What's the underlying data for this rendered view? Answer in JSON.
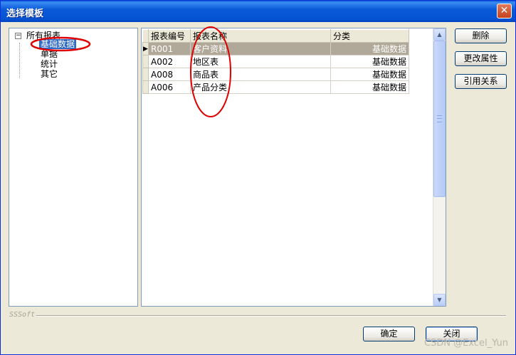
{
  "window": {
    "title": "选择模板",
    "close_glyph": "✕"
  },
  "tree": {
    "expander_glyph": "−",
    "root_label": "所有报表",
    "children": [
      {
        "label": "基础数据",
        "selected": true
      },
      {
        "label": "单据",
        "selected": false
      },
      {
        "label": "统计",
        "selected": false
      },
      {
        "label": "其它",
        "selected": false
      }
    ]
  },
  "grid": {
    "columns": [
      "报表编号",
      "报表名称",
      "分类"
    ],
    "current_row_marker": "▶",
    "rows": [
      {
        "code": "R001",
        "name": "客户资料",
        "category": "基础数据",
        "selected": true
      },
      {
        "code": "A002",
        "name": "地区表",
        "category": "基础数据",
        "selected": false
      },
      {
        "code": "A008",
        "name": "商品表",
        "category": "基础数据",
        "selected": false
      },
      {
        "code": "A006",
        "name": "产品分类",
        "category": "基础数据",
        "selected": false
      }
    ]
  },
  "scrollbar": {
    "up_glyph": "▲",
    "down_glyph": "▼"
  },
  "side_buttons": {
    "delete": "删除",
    "edit_properties": "更改属性",
    "references": "引用关系"
  },
  "footer": {
    "separator_label": "SSSoft",
    "ok": "确定",
    "close": "关闭"
  },
  "watermark": "CSDN @Excel_Yun",
  "colors": {
    "title_bar": "#0453d3",
    "selection": "#316ac5",
    "selected_row": "#b0a898",
    "annotation": "#e00000"
  }
}
